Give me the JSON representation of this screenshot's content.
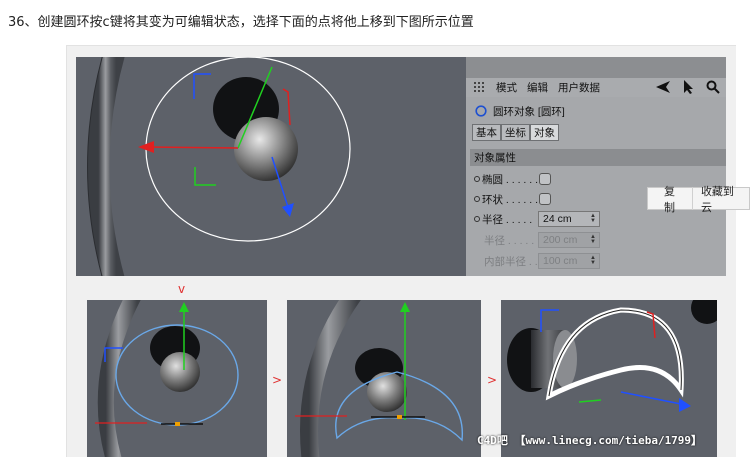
{
  "step": {
    "title": "36、创建圆环按c键将其变为可编辑状态，选择下面的点将他上移到下图所示位置"
  },
  "panel": {
    "menu": [
      "模式",
      "编辑",
      "用户数据"
    ],
    "object_label": "圆环对象 [圆环]",
    "tabs": [
      "基本",
      "坐标",
      "对象"
    ],
    "active_tab": "对象",
    "section_title": "对象属性",
    "props": {
      "ellipse_label": "椭圆 . . . . . .",
      "ring_label": "环状 . . . . . .",
      "radius_label": "半径 . . . . .",
      "radius_value": "24 cm",
      "radius2_label": "半径 . . . . .",
      "radius2_value": "200 cm",
      "inner_radius_label": "内部半径 . .",
      "inner_radius_value": "100 cm"
    }
  },
  "context_menu": {
    "items": [
      "复制",
      "收藏到云"
    ]
  },
  "arrows": {
    "down": "v",
    "right1": ">",
    "right2": ">"
  },
  "watermark": "C4D吧 【www.linecg.com/tieba/1799】",
  "colors": {
    "viewport_bg": "#5d6169",
    "panel_bg": "#a6a8ab",
    "axis_x": "#e02020",
    "axis_y": "#20d020",
    "axis_z": "#2050ff",
    "spline": "#6aa8e8"
  }
}
